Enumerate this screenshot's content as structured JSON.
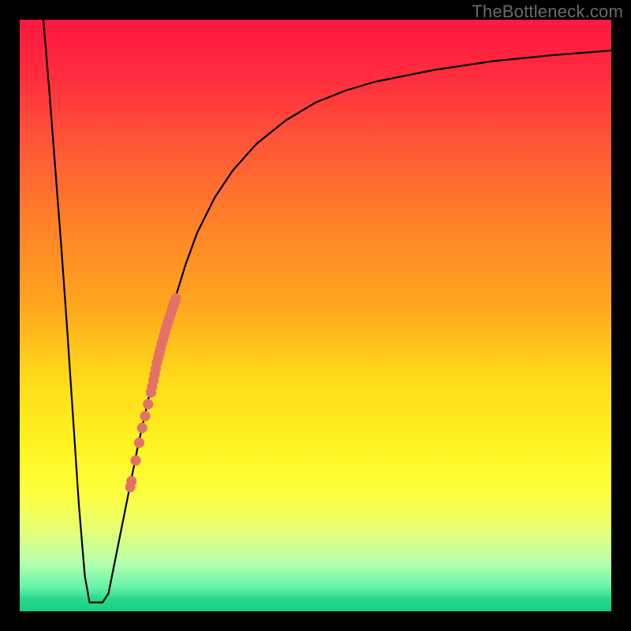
{
  "watermark": "TheBottleneck.com",
  "chart_data": {
    "type": "line",
    "title": "",
    "xlabel": "",
    "ylabel": "",
    "xlim": [
      0,
      100
    ],
    "ylim": [
      0,
      100
    ],
    "curve": [
      {
        "x": 4.0,
        "y": 100.0
      },
      {
        "x": 5.0,
        "y": 88.0
      },
      {
        "x": 6.0,
        "y": 75.0
      },
      {
        "x": 7.0,
        "y": 62.0
      },
      {
        "x": 8.0,
        "y": 48.0
      },
      {
        "x": 9.0,
        "y": 33.0
      },
      {
        "x": 10.0,
        "y": 18.0
      },
      {
        "x": 11.0,
        "y": 6.0
      },
      {
        "x": 11.8,
        "y": 1.5
      },
      {
        "x": 13.0,
        "y": 1.5
      },
      {
        "x": 14.0,
        "y": 1.5
      },
      {
        "x": 15.0,
        "y": 3.0
      },
      {
        "x": 16.0,
        "y": 8.0
      },
      {
        "x": 17.0,
        "y": 13.0
      },
      {
        "x": 18.0,
        "y": 18.0
      },
      {
        "x": 19.0,
        "y": 23.0
      },
      {
        "x": 20.0,
        "y": 28.0
      },
      {
        "x": 22.0,
        "y": 37.0
      },
      {
        "x": 24.0,
        "y": 45.0
      },
      {
        "x": 26.0,
        "y": 52.0
      },
      {
        "x": 28.0,
        "y": 58.5
      },
      {
        "x": 30.0,
        "y": 64.0
      },
      {
        "x": 33.0,
        "y": 70.0
      },
      {
        "x": 36.0,
        "y": 74.5
      },
      {
        "x": 40.0,
        "y": 79.0
      },
      {
        "x": 45.0,
        "y": 83.0
      },
      {
        "x": 50.0,
        "y": 86.0
      },
      {
        "x": 55.0,
        "y": 88.0
      },
      {
        "x": 60.0,
        "y": 89.5
      },
      {
        "x": 70.0,
        "y": 91.5
      },
      {
        "x": 80.0,
        "y": 93.0
      },
      {
        "x": 90.0,
        "y": 94.0
      },
      {
        "x": 100.0,
        "y": 94.8
      }
    ],
    "highlight_points": [
      {
        "x": 18.7,
        "y": 21.0
      },
      {
        "x": 18.9,
        "y": 22.0
      },
      {
        "x": 19.6,
        "y": 25.5
      },
      {
        "x": 20.2,
        "y": 28.5
      },
      {
        "x": 20.7,
        "y": 31.0
      },
      {
        "x": 21.2,
        "y": 33.0
      },
      {
        "x": 21.7,
        "y": 35.0
      },
      {
        "x": 22.2,
        "y": 37.0
      },
      {
        "x": 22.4,
        "y": 38.0
      },
      {
        "x": 22.6,
        "y": 39.0
      },
      {
        "x": 22.8,
        "y": 40.0
      },
      {
        "x": 23.0,
        "y": 41.0
      },
      {
        "x": 23.2,
        "y": 42.0
      },
      {
        "x": 23.4,
        "y": 42.8
      },
      {
        "x": 23.6,
        "y": 43.6
      },
      {
        "x": 23.8,
        "y": 44.4
      },
      {
        "x": 24.0,
        "y": 45.2
      },
      {
        "x": 24.2,
        "y": 45.9
      },
      {
        "x": 24.4,
        "y": 46.6
      },
      {
        "x": 24.6,
        "y": 47.3
      },
      {
        "x": 24.8,
        "y": 48.0
      },
      {
        "x": 25.0,
        "y": 48.7
      },
      {
        "x": 25.2,
        "y": 49.3
      },
      {
        "x": 25.4,
        "y": 49.9
      },
      {
        "x": 25.6,
        "y": 50.5
      },
      {
        "x": 25.8,
        "y": 51.1
      },
      {
        "x": 26.0,
        "y": 51.7
      },
      {
        "x": 26.2,
        "y": 52.3
      },
      {
        "x": 26.4,
        "y": 52.9
      }
    ],
    "highlight_color": "#e47166",
    "highlight_radius": 6.6
  }
}
